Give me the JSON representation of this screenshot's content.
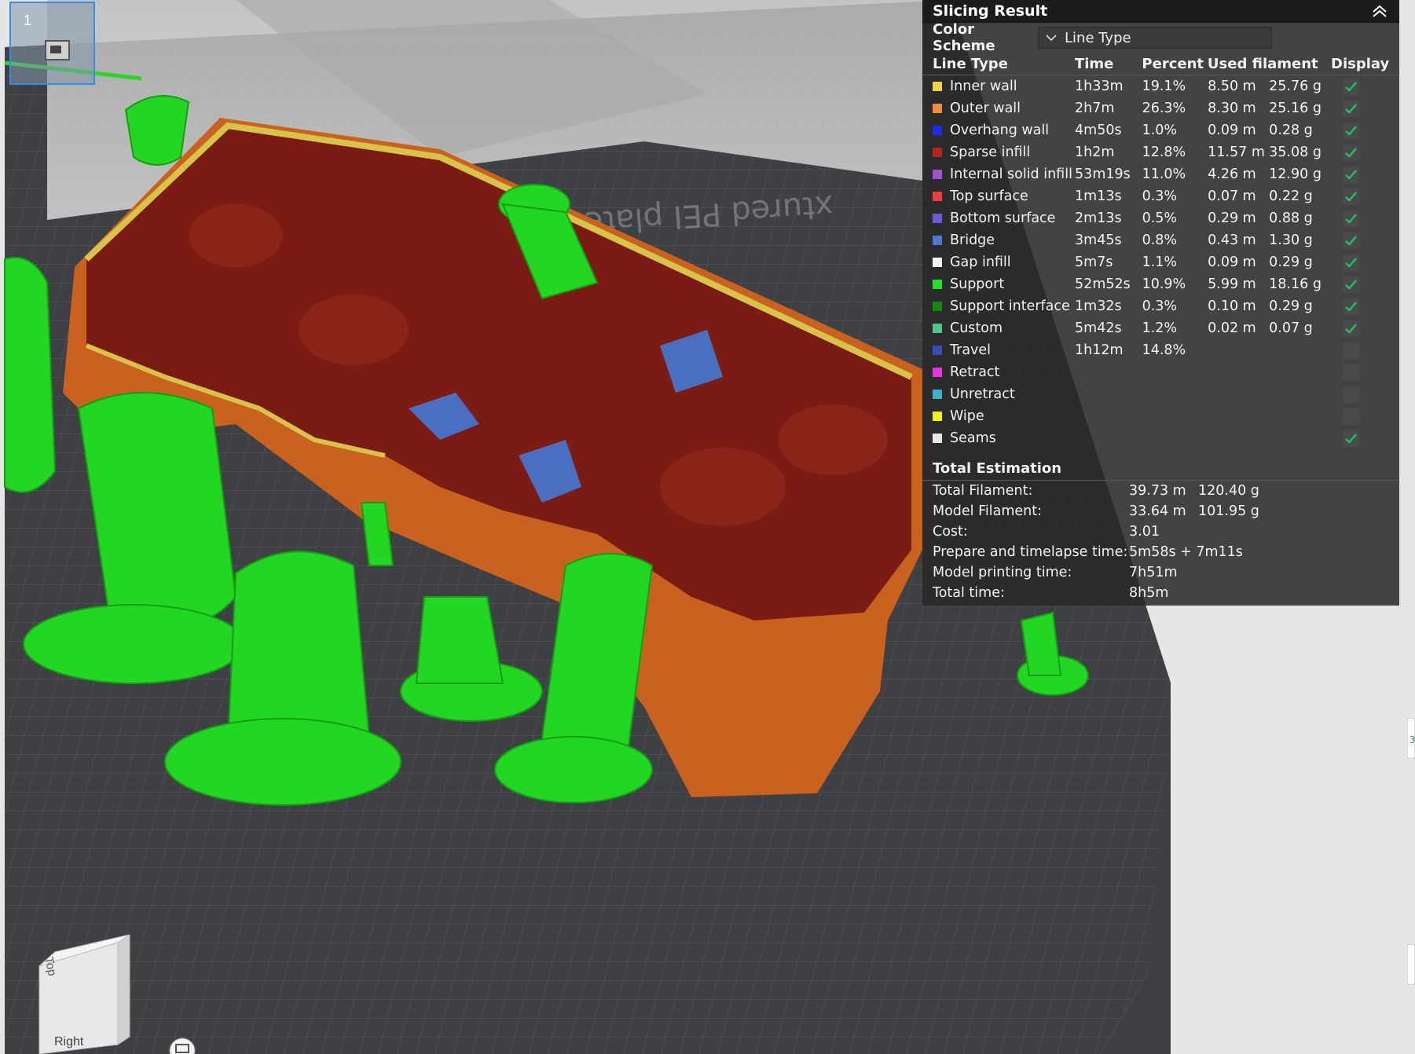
{
  "plate": {
    "number": "1"
  },
  "panel": {
    "title": "Slicing Result",
    "color_scheme_label": "Color Scheme",
    "color_scheme_value": "Line Type",
    "columns": [
      "Line Type",
      "Time",
      "Percent",
      "Used filament",
      "Display"
    ],
    "rows": [
      {
        "name": "Inner wall",
        "color": "#f2d448",
        "time": "1h33m",
        "percent": "19.1%",
        "meters": "8.50 m",
        "grams": "25.76 g",
        "display": true
      },
      {
        "name": "Outer wall",
        "color": "#f08a3c",
        "time": "2h7m",
        "percent": "26.3%",
        "meters": "8.30 m",
        "grams": "25.16 g",
        "display": true
      },
      {
        "name": "Overhang wall",
        "color": "#1b2bf0",
        "time": "4m50s",
        "percent": "1.0%",
        "meters": "0.09 m",
        "grams": "0.28 g",
        "display": true
      },
      {
        "name": "Sparse infill",
        "color": "#b0261c",
        "time": "1h2m",
        "percent": "12.8%",
        "meters": "11.57 m",
        "grams": "35.08 g",
        "display": true
      },
      {
        "name": "Internal solid infill",
        "color": "#a050d8",
        "time": "53m19s",
        "percent": "11.0%",
        "meters": "4.26 m",
        "grams": "12.90 g",
        "display": true
      },
      {
        "name": "Top surface",
        "color": "#f23c3c",
        "time": "1m13s",
        "percent": "0.3%",
        "meters": "0.07 m",
        "grams": "0.22 g",
        "display": true
      },
      {
        "name": "Bottom surface",
        "color": "#6a5ad8",
        "time": "2m13s",
        "percent": "0.5%",
        "meters": "0.29 m",
        "grams": "0.88 g",
        "display": true
      },
      {
        "name": "Bridge",
        "color": "#4a7ad0",
        "time": "3m45s",
        "percent": "0.8%",
        "meters": "0.43 m",
        "grams": "1.30 g",
        "display": true
      },
      {
        "name": "Gap infill",
        "color": "#f4f4f4",
        "time": "5m7s",
        "percent": "1.1%",
        "meters": "0.09 m",
        "grams": "0.29 g",
        "display": true
      },
      {
        "name": "Support",
        "color": "#22e022",
        "time": "52m52s",
        "percent": "10.9%",
        "meters": "5.99 m",
        "grams": "18.16 g",
        "display": true
      },
      {
        "name": "Support interface",
        "color": "#148a14",
        "time": "1m32s",
        "percent": "0.3%",
        "meters": "0.10 m",
        "grams": "0.29 g",
        "display": true
      },
      {
        "name": "Custom",
        "color": "#4ec880",
        "time": "5m42s",
        "percent": "1.2%",
        "meters": "0.02 m",
        "grams": "0.07 g",
        "display": true
      },
      {
        "name": "Travel",
        "color": "#3a4ab8",
        "time": "1h12m",
        "percent": "14.8%",
        "meters": "",
        "grams": "",
        "display": false
      },
      {
        "name": "Retract",
        "color": "#e632e6",
        "time": "",
        "percent": "",
        "meters": "",
        "grams": "",
        "display": false
      },
      {
        "name": "Unretract",
        "color": "#3cb0d0",
        "time": "",
        "percent": "",
        "meters": "",
        "grams": "",
        "display": false
      },
      {
        "name": "Wipe",
        "color": "#f4f014",
        "time": "",
        "percent": "",
        "meters": "",
        "grams": "",
        "display": false
      },
      {
        "name": "Seams",
        "color": "#e8e8e8",
        "time": "",
        "percent": "",
        "meters": "",
        "grams": "",
        "display": true
      }
    ],
    "total_heading": "Total Estimation",
    "estimates": [
      {
        "label": "Total Filament:",
        "v1": "39.73 m",
        "v2": "120.40 g"
      },
      {
        "label": "Model Filament:",
        "v1": "33.64 m",
        "v2": "101.95 g"
      },
      {
        "label": "Cost:",
        "v1": "3.01",
        "v2": ""
      },
      {
        "label": "Prepare and timelapse time:",
        "v1": "5m58s + 7m11s",
        "v2": ""
      },
      {
        "label": "Model printing time:",
        "v1": "7h51m",
        "v2": ""
      },
      {
        "label": "Total time:",
        "v1": "8h5m",
        "v2": ""
      }
    ]
  },
  "view_cube": {
    "top_label": "Top",
    "right_label": "Right"
  }
}
